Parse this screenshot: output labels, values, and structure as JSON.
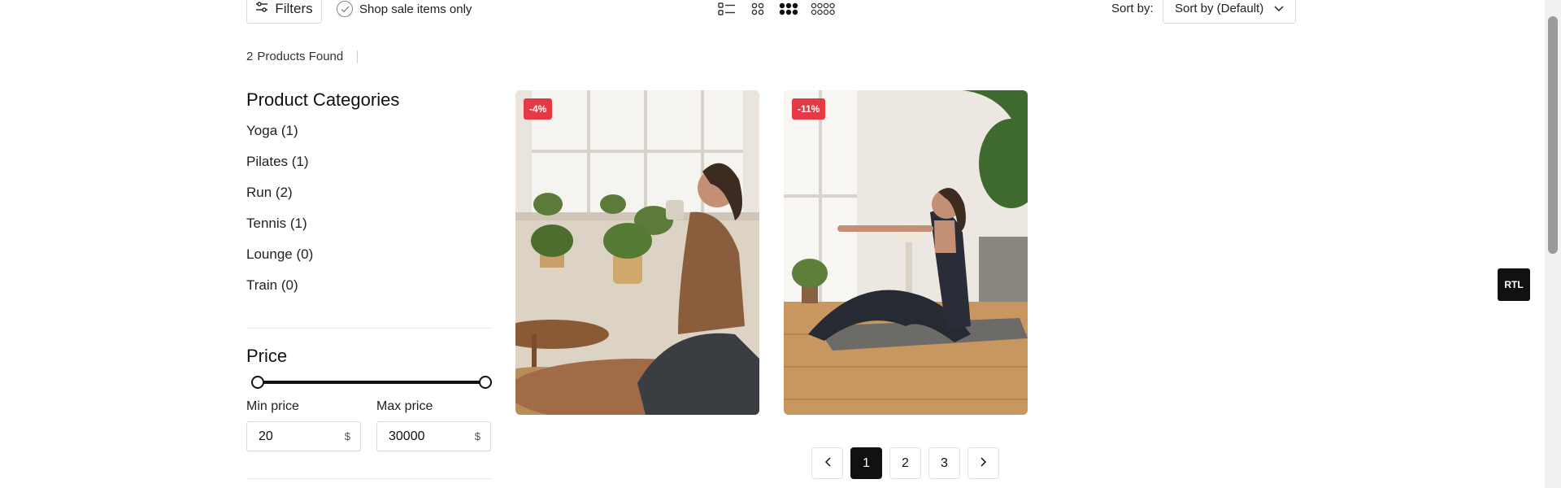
{
  "toolbar": {
    "filters_label": "Filters",
    "sale_label": "Shop sale items only",
    "sort_label": "Sort by:",
    "sort_value": "Sort by (Default)",
    "layouts": [
      "list-layout-icon",
      "grid-2-icon",
      "grid-3-icon",
      "grid-4-icon"
    ],
    "active_layout": "grid-3-icon"
  },
  "results": {
    "count": "2",
    "label": "Products Found"
  },
  "categories": {
    "title": "Product Categories",
    "items": [
      {
        "label": "Yoga (1)"
      },
      {
        "label": "Pilates (1)"
      },
      {
        "label": "Run (2)"
      },
      {
        "label": "Tennis (1)"
      },
      {
        "label": "Lounge (0)"
      },
      {
        "label": "Train (0)"
      }
    ]
  },
  "price": {
    "title": "Price",
    "min_label": "Min price",
    "max_label": "Max price",
    "min_value": "20",
    "max_value": "30000",
    "currency": "$"
  },
  "products": [
    {
      "badge": "-4%"
    },
    {
      "badge": "-11%"
    }
  ],
  "pagination": {
    "pages": [
      "1",
      "2",
      "3"
    ],
    "current": "1"
  },
  "rtl_label": "RTL",
  "colors": {
    "badge": "#e63946",
    "primary": "#111111"
  }
}
